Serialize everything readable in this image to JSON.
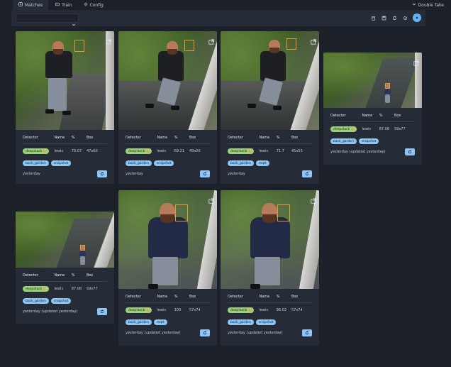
{
  "nav": {
    "tabs": [
      {
        "label": "Matches",
        "icon": "list-icon"
      },
      {
        "label": "Train",
        "icon": "image-icon"
      },
      {
        "label": "Config",
        "icon": "gear-icon"
      }
    ],
    "brand": "Double Take"
  },
  "toolbar": {
    "filter_value": "",
    "icons": [
      "trash-icon",
      "save-icon",
      "refresh-icon",
      "settings-icon",
      "close-icon"
    ]
  },
  "table_headers": {
    "detector": "Detector",
    "name": "Name",
    "pct": "%",
    "box": "Box"
  },
  "colors": {
    "detector_chip": "#9bd17a",
    "tag_chip": "#8ec5f2",
    "bbox": "#e39a3b",
    "accent": "#64b5f6"
  },
  "cards": [
    {
      "detector": "deepstack",
      "name": "lewis",
      "pct": "70.07",
      "box": "47x60",
      "tags": [
        "back_garden",
        "snapshot"
      ],
      "time": "yesterday"
    },
    {
      "detector": "deepstack",
      "name": "lewis",
      "pct": "69.21",
      "box": "49x56",
      "tags": [
        "back_garden",
        "snapshot"
      ],
      "time": "yesterday"
    },
    {
      "detector": "deepstack",
      "name": "lewis",
      "pct": "71.7",
      "box": "45x55",
      "tags": [
        "back_garden",
        "mqtt"
      ],
      "time": "yesterday"
    },
    {
      "detector": "deepstack",
      "name": "lewis",
      "pct": "87.08",
      "box": "59x77",
      "tags": [
        "back_garden",
        "snapshot"
      ],
      "time": "yesterday (updated yesterday)"
    },
    {
      "detector": "deepstack",
      "name": "lewis",
      "pct": "87.08",
      "box": "59x77",
      "tags": [
        "back_garden",
        "snapshot"
      ],
      "time": "yesterday (updated yesterday)"
    },
    {
      "detector": "deepstack",
      "name": "lewis",
      "pct": "100",
      "box": "57x74",
      "tags": [
        "back_garden",
        "mqtt"
      ],
      "time": "yesterday (updated yesterday)"
    },
    {
      "detector": "deepstack",
      "name": "lewis",
      "pct": "96.02",
      "box": "57x74",
      "tags": [
        "back_garden",
        "snapshot"
      ],
      "time": "yesterday (updated yesterday)"
    }
  ]
}
